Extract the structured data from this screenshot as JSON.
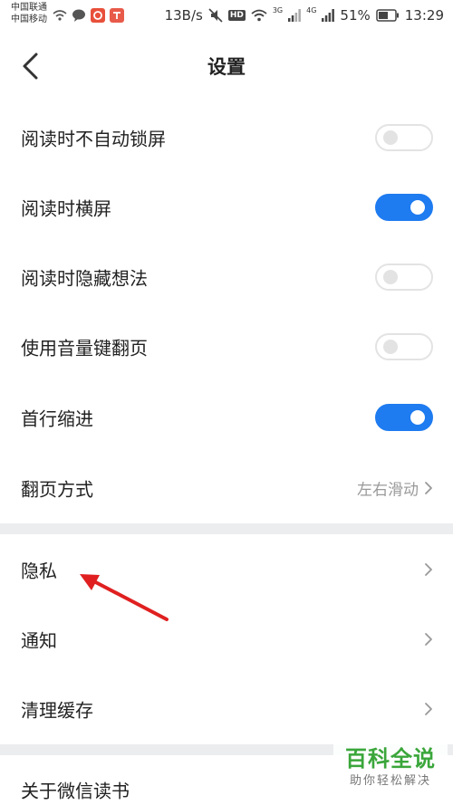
{
  "status_bar": {
    "carrier_1": "中国联通",
    "carrier_2": "中国移动",
    "speed": "13B/s",
    "hd": "HD",
    "net_3g": "3G",
    "net_4g": "4G",
    "battery": "51%",
    "time": "13:29"
  },
  "header": {
    "title": "设置",
    "back_icon": "chevron-left-icon"
  },
  "settings": [
    {
      "label": "阅读时不自动锁屏",
      "toggle": false
    },
    {
      "label": "阅读时横屏",
      "toggle": true
    },
    {
      "label": "阅读时隐藏想法",
      "toggle": false
    },
    {
      "label": "使用音量键翻页",
      "toggle": false
    },
    {
      "label": "首行缩进",
      "toggle": true
    },
    {
      "label": "翻页方式",
      "value": "左右滑动"
    }
  ],
  "section2": [
    {
      "label": "隐私"
    },
    {
      "label": "通知"
    },
    {
      "label": "清理缓存"
    }
  ],
  "section3": [
    {
      "label": "关于微信读书"
    }
  ],
  "colors": {
    "accent": "#1e7bf0",
    "annotation": "#e02020",
    "watermark": "#3aa63a"
  },
  "watermark": {
    "main": "百科全说",
    "sub": "助你轻松解决"
  }
}
